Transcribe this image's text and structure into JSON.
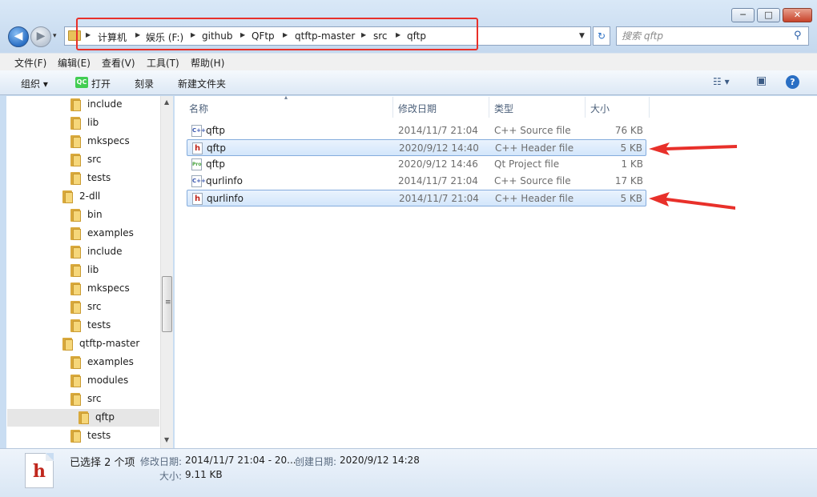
{
  "window": {
    "minimize_glyph": "─",
    "maximize_glyph": "□",
    "close_glyph": "✕"
  },
  "nav": {
    "back_glyph": "◀",
    "forward_glyph": "▶",
    "dropdown_glyph": "▾"
  },
  "address": {
    "breadcrumbs": [
      "计算机",
      "娱乐 (F:)",
      "github",
      "QFtp",
      "qtftp-master",
      "src",
      "qftp"
    ],
    "separator": "▶",
    "dropdown_glyph": "▼",
    "refresh_glyph": "↻"
  },
  "search": {
    "placeholder": "搜索 qftp",
    "icon": "search-icon",
    "icon_glyph": "⚲"
  },
  "menubar": {
    "items": [
      "文件(F)",
      "编辑(E)",
      "查看(V)",
      "工具(T)",
      "帮助(H)"
    ]
  },
  "toolbar": {
    "organize": "组织 ▾",
    "open_icon_text": "QC",
    "open": "打开",
    "burn": "刻录",
    "new_folder": "新建文件夹",
    "views_glyph": "☷ ▾",
    "preview_glyph": "▣",
    "help_glyph": "?"
  },
  "tree": [
    {
      "label": "include"
    },
    {
      "label": "lib"
    },
    {
      "label": "mkspecs"
    },
    {
      "label": "src"
    },
    {
      "label": "tests"
    },
    {
      "label": "2-dll"
    },
    {
      "label": "bin"
    },
    {
      "label": "examples"
    },
    {
      "label": "include"
    },
    {
      "label": "lib"
    },
    {
      "label": "mkspecs"
    },
    {
      "label": "src"
    },
    {
      "label": "tests"
    },
    {
      "label": "qtftp-master"
    },
    {
      "label": "examples"
    },
    {
      "label": "modules"
    },
    {
      "label": "src"
    },
    {
      "label": "qftp"
    },
    {
      "label": "tests"
    }
  ],
  "scrollbar": {
    "up_glyph": "▲",
    "down_glyph": "▼",
    "grip_glyph": "≡"
  },
  "columns": {
    "name": "名称",
    "date": "修改日期",
    "type": "类型",
    "size": "大小",
    "sort_glyph": "▴"
  },
  "files": [
    {
      "name": "qftp",
      "date": "2014/11/7 21:04",
      "type": "C++ Source file",
      "size": "76 KB",
      "icon": "cpp-file-icon",
      "icon_text": "C++",
      "selected": false
    },
    {
      "name": "qftp",
      "date": "2020/9/12 14:40",
      "type": "C++ Header file",
      "size": "5 KB",
      "icon": "header-file-icon",
      "icon_text": "h",
      "selected": true
    },
    {
      "name": "qftp",
      "date": "2020/9/12 14:46",
      "type": "Qt Project file",
      "size": "1 KB",
      "icon": "qt-project-file-icon",
      "icon_text": "Pro",
      "selected": false
    },
    {
      "name": "qurlinfo",
      "date": "2014/11/7 21:04",
      "type": "C++ Source file",
      "size": "17 KB",
      "icon": "cpp-file-icon",
      "icon_text": "C++",
      "selected": false
    },
    {
      "name": "qurlinfo",
      "date": "2014/11/7 21:04",
      "type": "C++ Header file",
      "size": "5 KB",
      "icon": "header-file-icon",
      "icon_text": "h",
      "selected": true
    }
  ],
  "details": {
    "icon_text": "h",
    "selection": "已选择 2 个项",
    "modified_label": "修改日期:",
    "modified_value": "2014/11/7 21:04 - 20...",
    "created_label": "创建日期:",
    "created_value": "2020/9/12 14:28",
    "size_label": "大小:",
    "size_value": "9.11 KB"
  },
  "colors": {
    "annotation_red": "#e8302a",
    "selection_border": "#84acdd"
  }
}
